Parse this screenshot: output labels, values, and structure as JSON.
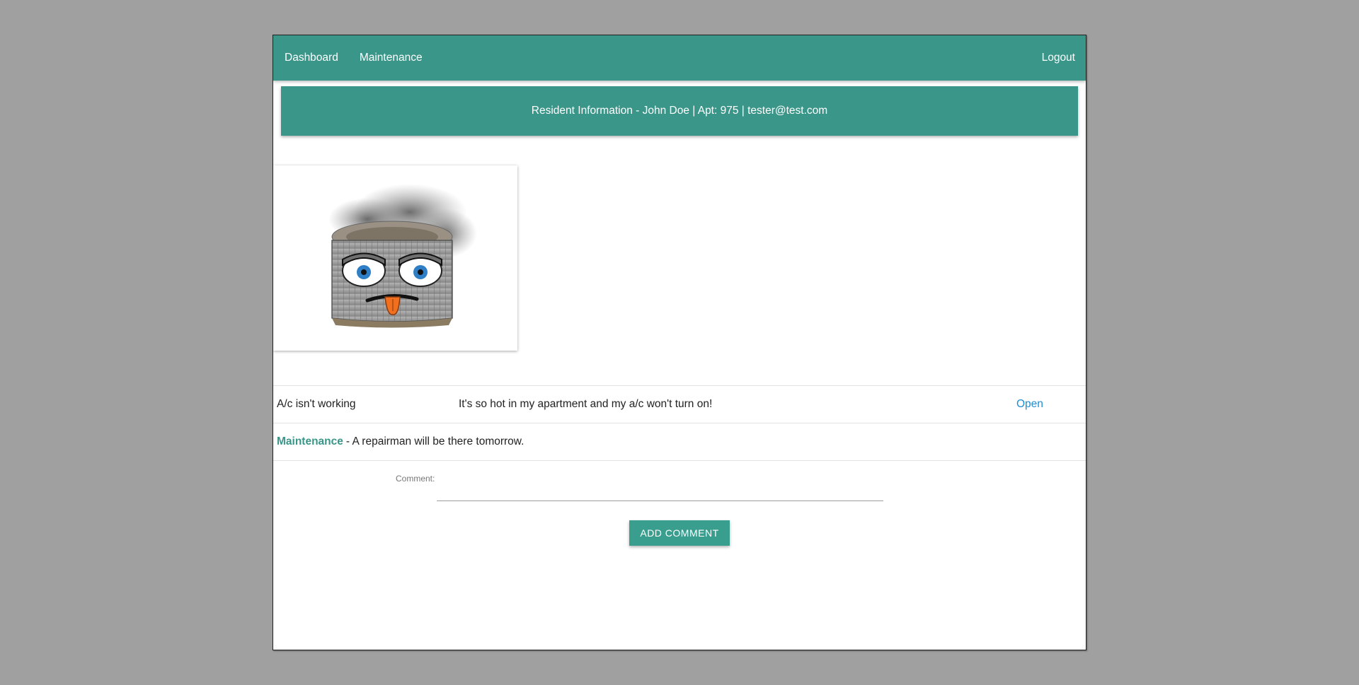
{
  "nav": {
    "dashboard": "Dashboard",
    "maintenance": "Maintenance",
    "logout": "Logout"
  },
  "banner": {
    "text": "Resident Information - John Doe | Apt: 975 | tester@test.com"
  },
  "photo": {
    "icon": "broken-ac-unit-image"
  },
  "request": {
    "title": "A/c isn't working",
    "description": "It's so hot in my apartment and my a/c won't turn on!",
    "status": "Open"
  },
  "comments": [
    {
      "author": "Maintenance",
      "text": "- A repairman will be there tomorrow."
    }
  ],
  "form": {
    "label": "Comment:",
    "value": "",
    "button": "ADD COMMENT"
  },
  "colors": {
    "primary": "#3a9688",
    "link": "#1a8ed6",
    "background": "#a0a0a0"
  }
}
